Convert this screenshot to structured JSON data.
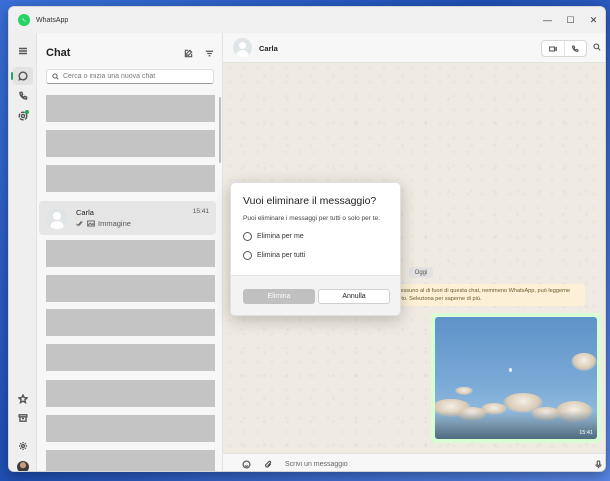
{
  "window": {
    "app_title": "WhatsApp",
    "min_glyph": "—",
    "max_glyph": "☐",
    "close_glyph": "✕"
  },
  "rail": {
    "items": [
      "menu-icon",
      "chats-icon",
      "calls-icon",
      "status-icon",
      "starred-icon",
      "archive-icon",
      "settings-icon",
      "profile-avatar"
    ]
  },
  "sidebar": {
    "title": "Chat",
    "search_placeholder": "Cerca o inizia una nuova chat",
    "selected_chat": {
      "name": "Carla",
      "time": "15:41",
      "preview": "Immagine"
    }
  },
  "conversation": {
    "contact_name": "Carla",
    "date_chip": "Oggi",
    "encryption_note": "i. Nessuno al di fuori di questa chat, nemmeno WhatsApp, può leggerne\nenuto. Seleziona per saperne di più.",
    "image_time": "15:41",
    "composer_placeholder": "Scrivi un messaggio"
  },
  "dialog": {
    "title": "Vuoi eliminare il messaggio?",
    "description": "Puoi eliminare i messaggi per tutti o solo per te.",
    "option_me": "Elimina per me",
    "option_all": "Elimina per tutti",
    "delete_label": "Elimina",
    "cancel_label": "Annulla"
  },
  "colors": {
    "accent": "#1fa855",
    "chat_background": "#efeae2",
    "outgoing_bubble": "#d9fdd3",
    "placeholder_row": "#c4c4c4"
  }
}
